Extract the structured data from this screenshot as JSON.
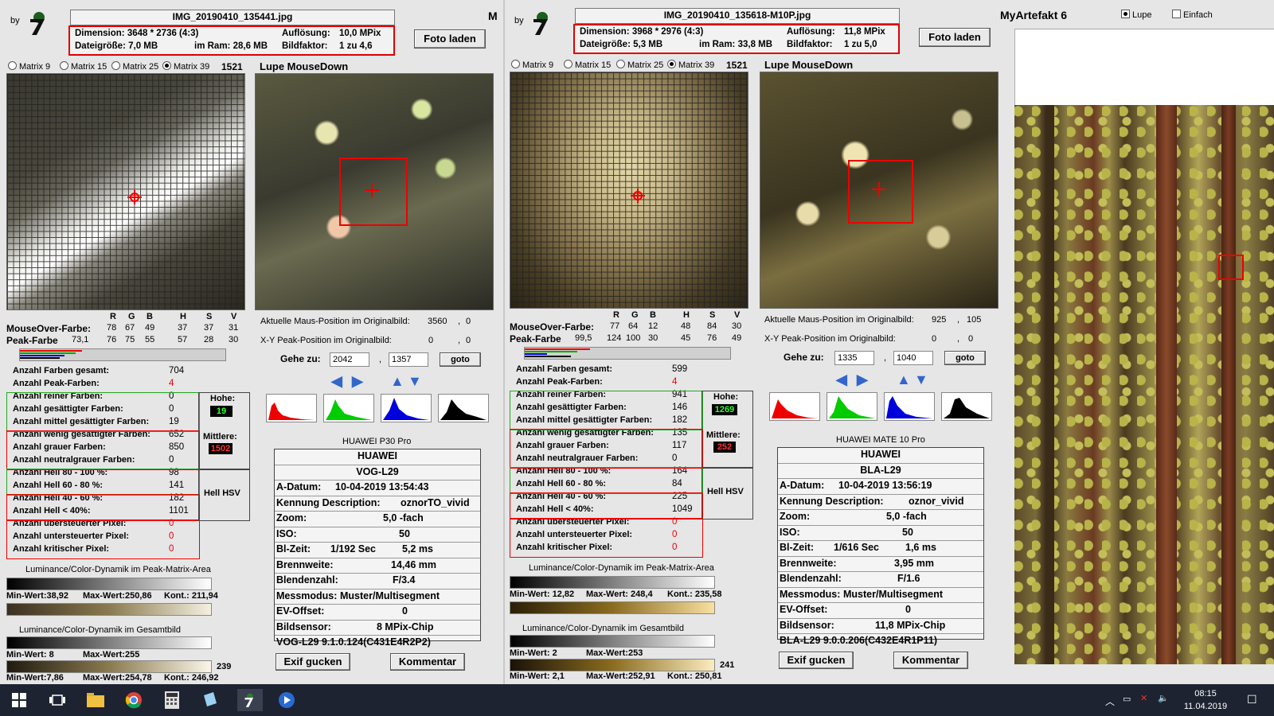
{
  "common": {
    "by": "by",
    "foto_laden": "Foto laden",
    "radios": [
      "Matrix 9",
      "Matrix 15",
      "Matrix 25",
      "Matrix 39"
    ],
    "lupe_title": "Lupe MouseDown",
    "rgbhsv": [
      "R",
      "G",
      "B",
      "H",
      "S",
      "V"
    ],
    "mouseover_label": "MouseOver-Farbe:",
    "peak_label": "Peak-Farbe",
    "pos_label": "Aktuelle Maus-Position  im Originalbild:",
    "xy_label": "X-Y Peak-Position  im Originalbild:",
    "gehe_zu": "Gehe zu:",
    "goto": "goto",
    "stats_labels": [
      "Anzahl Farben gesamt:",
      "Anzahl Peak-Farben:",
      "Anzahl reiner Farben:",
      "Anzahl gesättigter Farben:",
      "Anzahl mittel gesättigter Farben:",
      "Anzahl wenig gesättigter Farben:",
      "Anzahl grauer Farben:",
      "Anzahl neutralgrauer Farben:",
      "Anzahl Hell 80 - 100 %:",
      "Anzahl Hell 60 - 80 %:",
      "Anzahl Hell 40 - 60 %:",
      "Anzahl Hell < 40%:",
      "Anzahl übersteuerter Pixel:",
      "Anzahl untersteuerter Pixel:",
      "Anzahl kritischer Pixel:"
    ],
    "hohe": "Hohe:",
    "mittlere": "Mittlere:",
    "hell_hsv": "Hell HSV",
    "lum_peak": "Luminance/Color-Dynamik im Peak-Matrix-Area",
    "lum_gesamt": "Luminance/Color-Dynamik im Gesamtbild",
    "min_wert": "Min-Wert:",
    "max_wert": "Max-Wert:",
    "kont": "Kont.:",
    "exif_labels": [
      "A-Datum:",
      "Kennung Description:",
      "Zoom:",
      "ISO:",
      "Bl-Zeit:",
      "Brennweite:",
      "Blendenzahl:",
      "Messmodus:",
      "EV-Offset:",
      "Bildsensor:"
    ],
    "exif_btn": "Exif gucken",
    "kommentar_btn": "Kommentar",
    "dimension_label": "Dimension:",
    "dateigroesse_label": "Dateigröße:",
    "ram_label": "im Ram:",
    "aufloesung_label": "Auflösung:",
    "bildfaktor_label": "Bildfaktor:"
  },
  "left": {
    "filename": "IMG_20190410_135441.jpg",
    "dimension": "3648 * 2736 (4:3)",
    "dateigroesse": "7,0 MB",
    "ram": "28,6 MB",
    "aufloesung": "10,0 MPix",
    "bildfaktor": "1 zu 4,6",
    "matrix_count": "1521",
    "mouseover": [
      "78",
      "67",
      "49",
      "37",
      "37",
      "31"
    ],
    "peak_extra": "73,1",
    "peak": [
      "76",
      "75",
      "55",
      "57",
      "28",
      "30"
    ],
    "pos": [
      "3560",
      "0"
    ],
    "xy": [
      "0",
      "0"
    ],
    "goto_x": "2042",
    "goto_y": "1357",
    "stats": [
      "704",
      "4",
      "0",
      "0",
      "19",
      "652",
      "850",
      "0",
      "98",
      "141",
      "182",
      "1101",
      "0",
      "0",
      "0"
    ],
    "hohe_val": "19",
    "mittlere_val": "1502",
    "device_small": "HUAWEI P30 Pro",
    "maker": "HUAWEI",
    "model": "VOG-L29",
    "a_datum": "10-04-2019 13:54:43",
    "kennung": "oznorTO_vivid",
    "zoom": "5,0 -fach",
    "iso": "50",
    "blzeit": "1/192 Sec",
    "blzeit_ms": "5,2 ms",
    "brennweite": "14,46 mm",
    "blendenzahl": "F/3.4",
    "messmodus": "Muster/Multisegment",
    "ev": "0",
    "sensor": "8 MPix-Chip",
    "firmware": "VOG-L29 9.1.0.124(C431E4R2P2)",
    "lp_min": "38,92",
    "lp_max": "250,86",
    "lp_kont": "211,94",
    "lg_min": "8",
    "lg_max": "255",
    "lg_num": "239",
    "lg2_min": "7,86",
    "lg2_max": "254,78",
    "lg2_kont": "246,92"
  },
  "right": {
    "filename": "IMG_20190410_135618-M10P.jpg",
    "dimension": "3968 * 2976 (4:3)",
    "dateigroesse": "5,3 MB",
    "ram": "33,8 MB",
    "aufloesung": "11,8 MPix",
    "bildfaktor": "1 zu 5,0",
    "matrix_count": "1521",
    "mouseover": [
      "77",
      "64",
      "12",
      "48",
      "84",
      "30"
    ],
    "peak_extra": "99,5",
    "peak": [
      "124",
      "100",
      "30",
      "45",
      "76",
      "49"
    ],
    "pos": [
      "925",
      "105"
    ],
    "xy": [
      "0",
      "0"
    ],
    "goto_x": "1335",
    "goto_y": "1040",
    "stats": [
      "599",
      "4",
      "941",
      "146",
      "182",
      "135",
      "117",
      "0",
      "164",
      "84",
      "225",
      "1049",
      "0",
      "0",
      "0"
    ],
    "hohe_val": "1269",
    "mittlere_val": "252",
    "device_small": "HUAWEI MATE 10 Pro",
    "maker": "HUAWEI",
    "model": "BLA-L29",
    "a_datum": "10-04-2019 13:56:19",
    "kennung": "oznor_vivid",
    "zoom": "5,0 -fach",
    "iso": "50",
    "blzeit": "1/616 Sec",
    "blzeit_ms": "1,6 ms",
    "brennweite": "3,95  mm",
    "blendenzahl": "F/1.6",
    "messmodus": "Muster/Multisegment",
    "ev": "0",
    "sensor": "11,8 MPix-Chip",
    "firmware": "BLA-L29 9.0.0.206(C432E4R1P11)",
    "lp_min": "12,82",
    "lp_max": "248,4",
    "lp_kont": "235,58",
    "lg_min": "2",
    "lg_max": "253",
    "lg_num": "241",
    "lg2_min": "2,1",
    "lg2_max": "252,91",
    "lg2_kont": "250,81"
  },
  "app": {
    "title": "MyArtefakt 6",
    "title_clip": "M",
    "lupe": "Lupe",
    "einfach": "Einfach"
  },
  "taskbar": {
    "time": "08:15",
    "date": "11.04.2019",
    "icons": [
      "windows-start-icon",
      "task-view-icon",
      "file-explorer-icon",
      "chrome-icon",
      "calculator-icon",
      "notepad-icon",
      "myartefakt-app-icon",
      "media-player-icon"
    ]
  },
  "colors": {
    "accent_red": "#e00000",
    "hist_red": "#e00000",
    "hist_green": "#00c000",
    "hist_blue": "#0000e0",
    "badge_green": "#00a000",
    "badge_red": "#c00000"
  }
}
